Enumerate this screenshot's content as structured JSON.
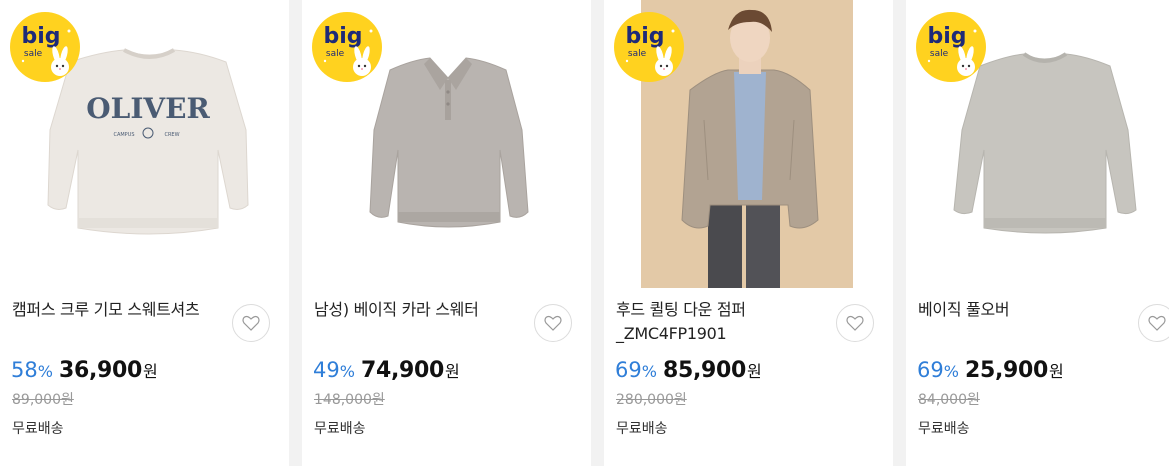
{
  "badge": {
    "line1": "big",
    "line2": "sale"
  },
  "products": [
    {
      "title": "캠퍼스 크루 기모 스웨트셔츠",
      "discount": "58",
      "pct_sign": "%",
      "price": "36,900",
      "currency": "원",
      "original_price": "89,000원",
      "shipping": "무료배송",
      "print_text": "OLIVER"
    },
    {
      "title": "남성) 베이직 카라 스웨터",
      "discount": "49",
      "pct_sign": "%",
      "price": "74,900",
      "currency": "원",
      "original_price": "148,000원",
      "shipping": "무료배송"
    },
    {
      "title": "후드 퀼팅 다운 점퍼 _ZMC4FP1901",
      "discount": "69",
      "pct_sign": "%",
      "price": "85,900",
      "currency": "원",
      "original_price": "280,000원",
      "shipping": "무료배송"
    },
    {
      "title": "베이직 풀오버",
      "discount": "69",
      "pct_sign": "%",
      "price": "25,900",
      "currency": "원",
      "original_price": "84,000원",
      "shipping": "무료배송"
    }
  ],
  "colors": {
    "discount": "#2f7ed8",
    "badge": "#ffd21f",
    "badge_text": "#1e2a78"
  }
}
